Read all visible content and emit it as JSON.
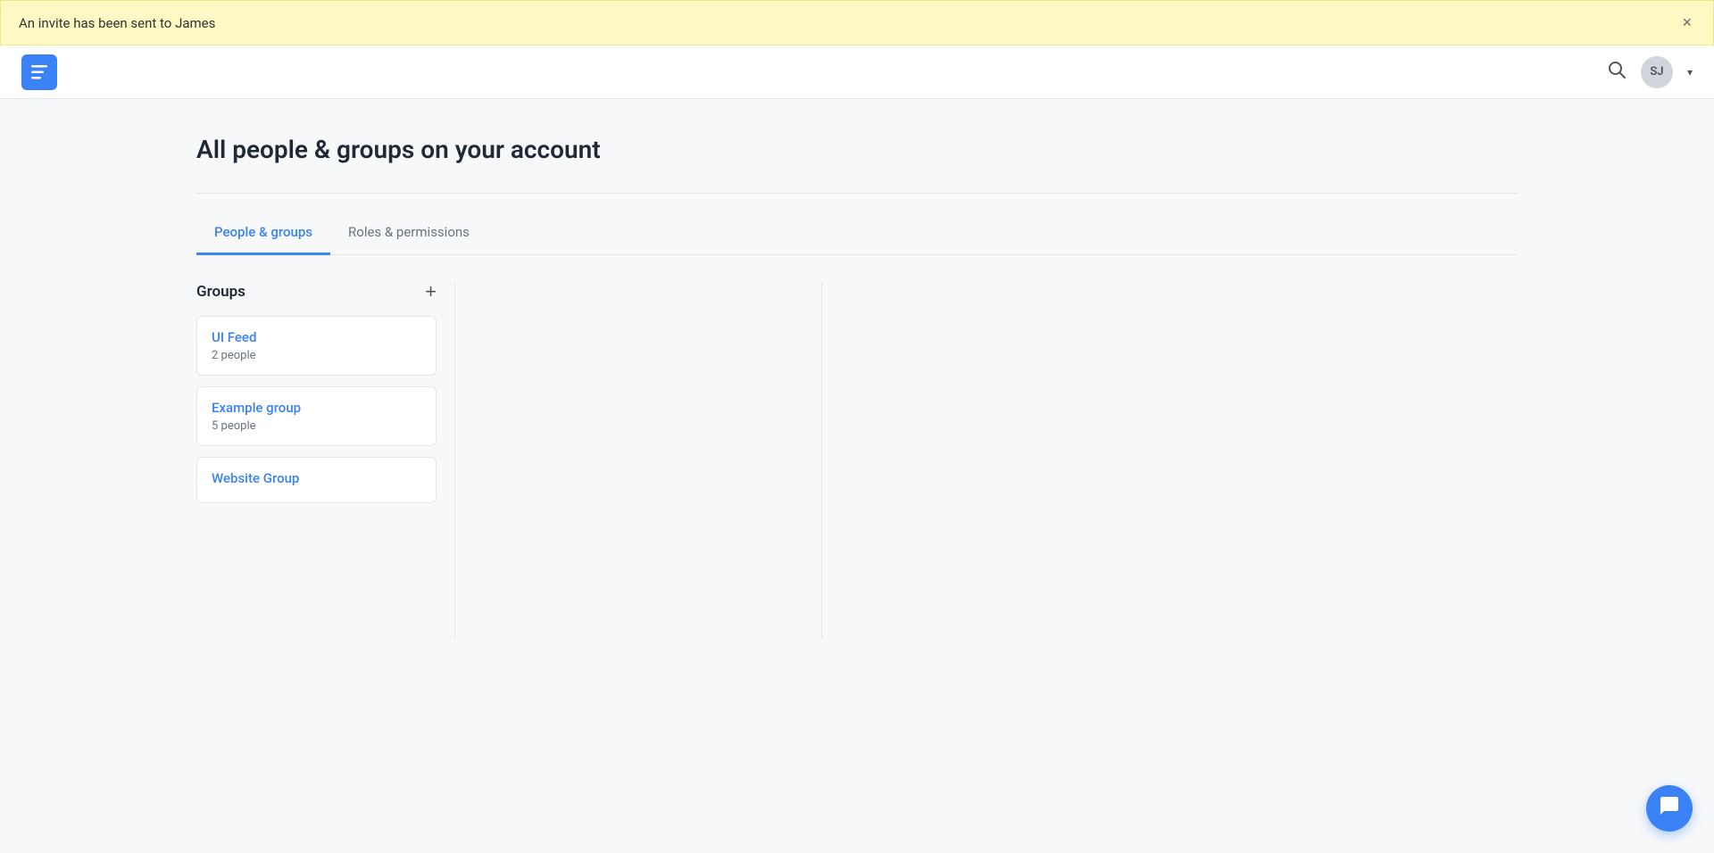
{
  "notification": {
    "message": "An invite has been sent to James",
    "close_label": "×"
  },
  "nav": {
    "logo_icon": "≡",
    "logo_aria": "App logo",
    "search_icon": "🔍",
    "avatar_initials": "SJ",
    "dropdown_arrow": "▾"
  },
  "page": {
    "title": "All people & groups on your account"
  },
  "tabs": [
    {
      "label": "People & groups",
      "active": true
    },
    {
      "label": "Roles & permissions",
      "active": false
    }
  ],
  "groups": {
    "heading": "Groups",
    "add_icon": "+",
    "items": [
      {
        "name": "UI Feed",
        "count": "2 people"
      },
      {
        "name": "Example group",
        "count": "5 people"
      },
      {
        "name": "Website Group",
        "count": ""
      }
    ]
  }
}
